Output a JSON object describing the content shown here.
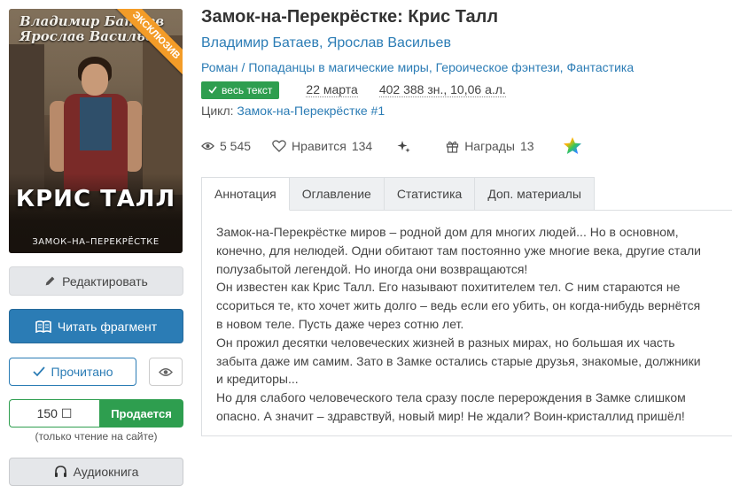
{
  "cover": {
    "authors": [
      "Владимир Батаев",
      "Ярослав Васильев"
    ],
    "title": "КРИС ТАЛЛ",
    "subtitle": "ЗАМОК–НА–ПЕРЕКРЁСТКЕ",
    "ribbon": "ЭКСКЛЮЗИВ"
  },
  "actions": {
    "edit": "Редактировать",
    "read_fragment": "Читать фрагмент",
    "read_done": "Прочитано",
    "price": "150 ☐",
    "sell": "Продается",
    "only_site": "(только чтение на сайте)",
    "audiobook": "Аудиокнига"
  },
  "book": {
    "title": "Замок-на-Перекрёстке: Крис Талл",
    "authors": [
      "Владимир Батаев",
      "Ярослав Васильев"
    ],
    "genre_root": "Роман",
    "genres": [
      "Попаданцы в магические миры",
      "Героическое фэнтези",
      "Фантастика"
    ],
    "badge": "весь текст",
    "date": "22 марта",
    "size": "402 388 зн., 10,06 а.л.",
    "cycle_label": "Цикл:",
    "cycle": "Замок-на-Перекрёстке #1"
  },
  "stats": {
    "views": "5 545",
    "likes_label": "Нравится",
    "likes": "134",
    "awards_label": "Награды",
    "awards": "13"
  },
  "tabs": [
    "Аннотация",
    "Оглавление",
    "Статистика",
    "Доп. материалы"
  ],
  "annotation": [
    "Замок-на-Перекрёстке миров – родной дом для многих людей... Но в основном, конечно, для нелюдей. Одни обитают там постоянно уже многие века, другие стали полузабытой легендой. Но иногда они возвращаются!",
    "Он известен как Крис Талл. Его называют похитителем тел. С ним стараются не ссориться те, кто хочет жить долго – ведь если его убить, он когда-нибудь вернётся в новом теле. Пусть даже через сотню лет.",
    "Он прожил десятки человеческих жизней в разных мирах, но большая их часть забыта даже им самим. Зато в Замке остались старые друзья, знакомые, должники и кредиторы...",
    "Но для слабого человеческого тела сразу после перерождения в Замке слишком опасно. А значит – здравствуй, новый мир! Не ждали? Воин-кристаллид пришёл!"
  ],
  "colors": {
    "link": "#2b7cb5",
    "green": "#2e9e4f",
    "ribbon": "#f39c28"
  }
}
